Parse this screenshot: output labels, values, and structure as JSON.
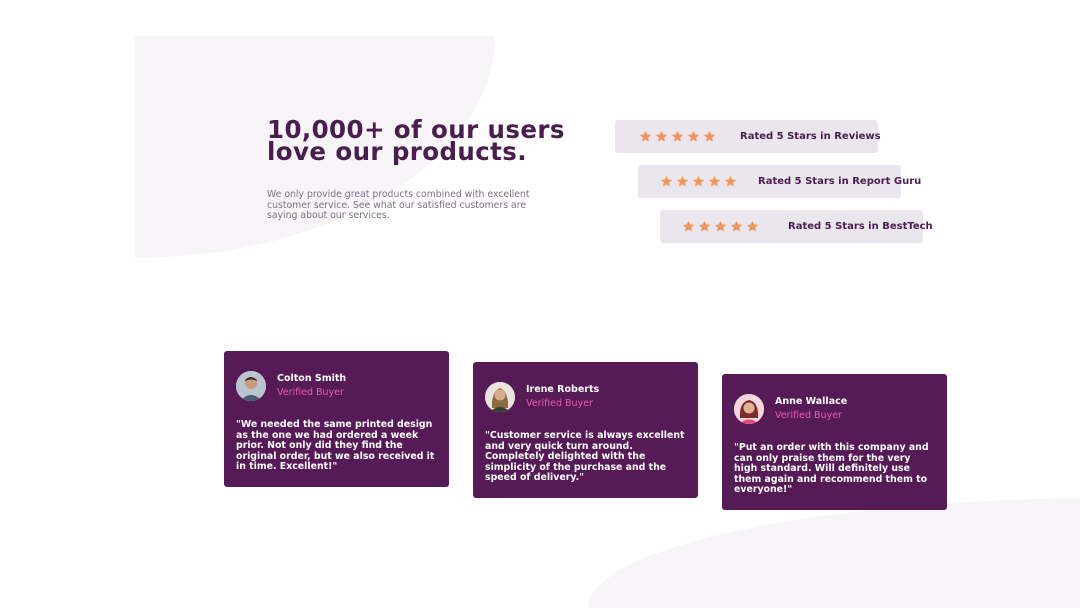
{
  "hero": {
    "heading": "10,000+ of our users love our products.",
    "description": "We only provide great products combined with excellent customer service. See what our satisfied customers are saying about our services."
  },
  "ratings": [
    {
      "label": "Rated 5 Stars in Reviews",
      "stars": 5
    },
    {
      "label": "Rated 5 Stars in Report Guru",
      "stars": 5
    },
    {
      "label": "Rated 5 Stars in BestTech",
      "stars": 5
    }
  ],
  "testimonials": [
    {
      "name": "Colton Smith",
      "role": "Verified Buyer",
      "quote": "\"We needed the same printed design as the one we had ordered a week prior. Not only did they find the original order, but we also received it in time. Excellent!\""
    },
    {
      "name": "Irene Roberts",
      "role": "Verified Buyer",
      "quote": "\"Customer service is always excellent and very quick turn around. Completely delighted with the simplicity of the purchase and the speed of delivery.\""
    },
    {
      "name": "Anne Wallace",
      "role": "Verified Buyer",
      "quote": "\"Put an order with this company and can only praise them for the very high standard. Will definitely use them again and recommend them to everyone!\""
    }
  ],
  "colors": {
    "primary": "#4a1d4f",
    "card": "#561b57",
    "accent": "#e85ca6",
    "star": "#f2975a",
    "rating_bg": "#ebe6ee"
  }
}
